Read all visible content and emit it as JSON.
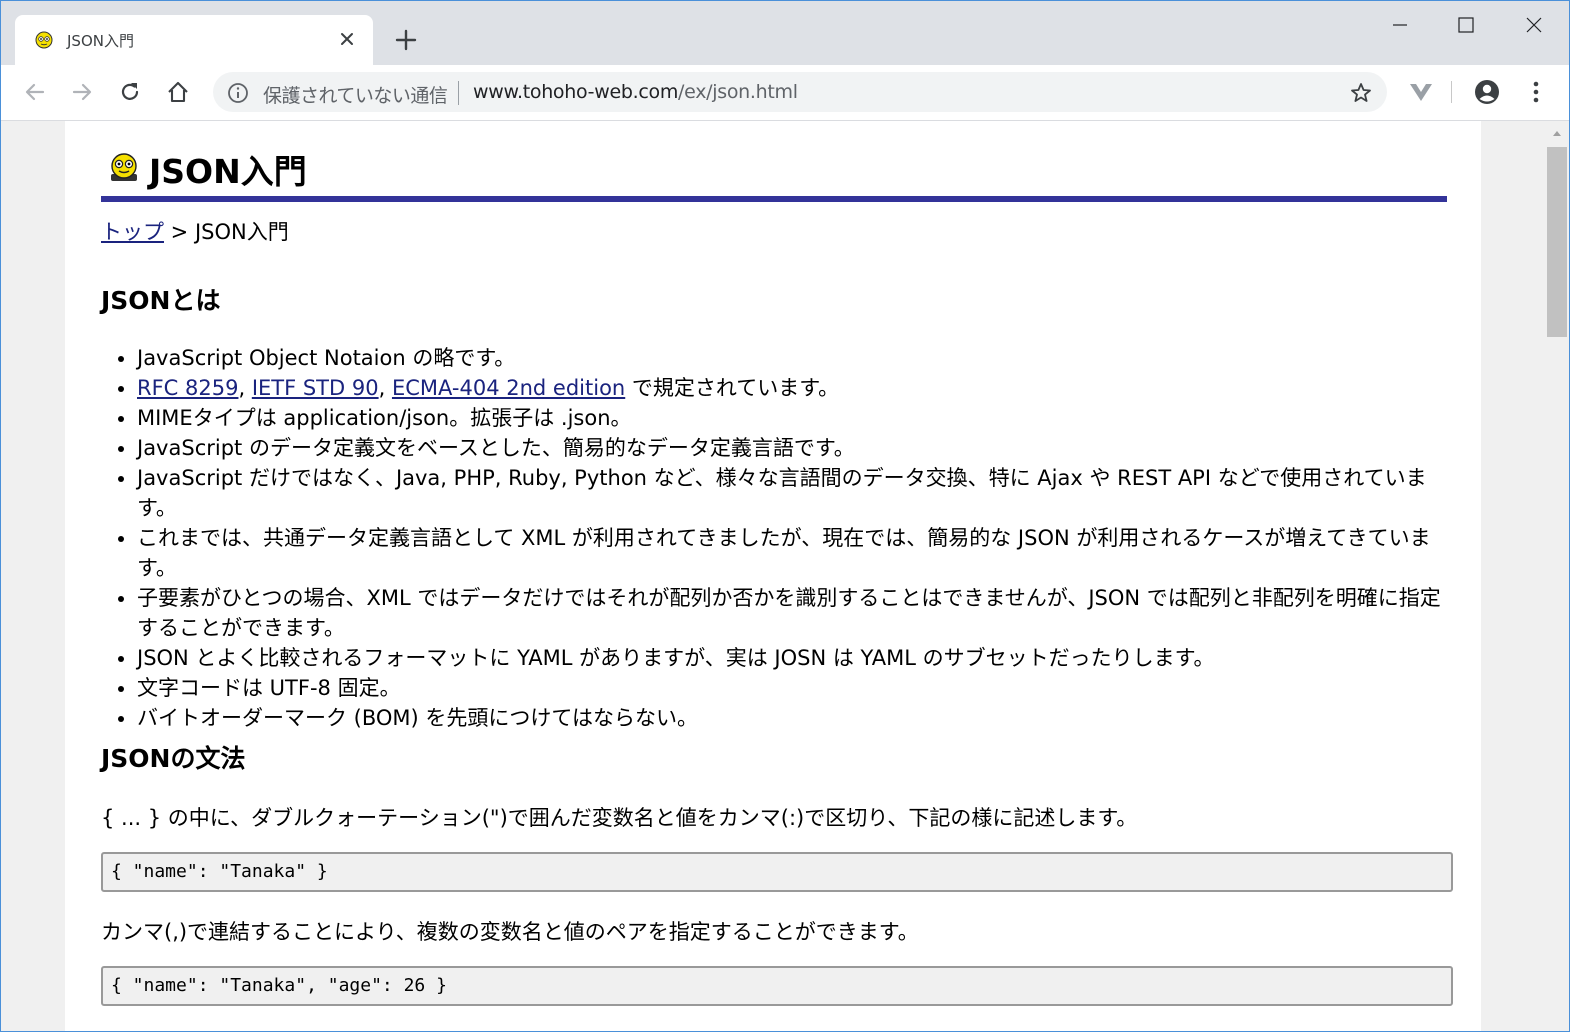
{
  "browser": {
    "tab_title": "JSON入門",
    "tab_close_label": "×",
    "new_tab_label": "+",
    "omnibox": {
      "security_text": "保護されていない通信",
      "url_host": "www.tohoho-web.com",
      "url_path": "/ex/json.html"
    }
  },
  "page": {
    "title": "JSON入門",
    "breadcrumb": {
      "home_link": "トップ",
      "separator": " > ",
      "current": "JSON入門"
    },
    "section1": {
      "heading": "JSONとは",
      "items": [
        {
          "text": "JavaScript Object Notaion の略です。"
        },
        {
          "link1": "RFC 8259",
          "sep1": ", ",
          "link2": "IETF STD 90",
          "sep2": ", ",
          "link3": "ECMA-404 2nd edition",
          "tail": " で規定されています。"
        },
        {
          "text": "MIMEタイプは application/json。拡張子は .json。"
        },
        {
          "text": "JavaScript のデータ定義文をベースとした、簡易的なデータ定義言語です。"
        },
        {
          "text": "JavaScript だけではなく、Java, PHP, Ruby, Python など、様々な言語間のデータ交換、特に Ajax や REST API などで使用されています。"
        },
        {
          "text": "これまでは、共通データ定義言語として XML が利用されてきましたが、現在では、簡易的な JSON が利用されるケースが増えてきています。"
        },
        {
          "text": "子要素がひとつの場合、XML ではデータだけではそれが配列か否かを識別することはできませんが、JSON では配列と非配列を明確に指定することができます。"
        },
        {
          "text": "JSON とよく比較されるフォーマットに YAML がありますが、実は JOSN は YAML のサブセットだったりします。"
        },
        {
          "text": "文字コードは UTF-8 固定。"
        },
        {
          "text": "バイトオーダーマーク (BOM) を先頭につけてはならない。"
        }
      ]
    },
    "section2": {
      "heading": "JSONの文法",
      "para1": "{ ... } の中に、ダブルクォーテーション(\")で囲んだ変数名と値をカンマ(:)で区切り、下記の様に記述します。",
      "code1": "{ \"name\": \"Tanaka\" }",
      "para2": "カンマ(,)で連結することにより、複数の変数名と値のペアを指定することができます。",
      "code2": "{ \"name\": \"Tanaka\", \"age\": 26 }"
    }
  },
  "colors": {
    "heading_rule": "#333399",
    "link": "#1a237e",
    "code_bg": "#f0f0f0"
  }
}
